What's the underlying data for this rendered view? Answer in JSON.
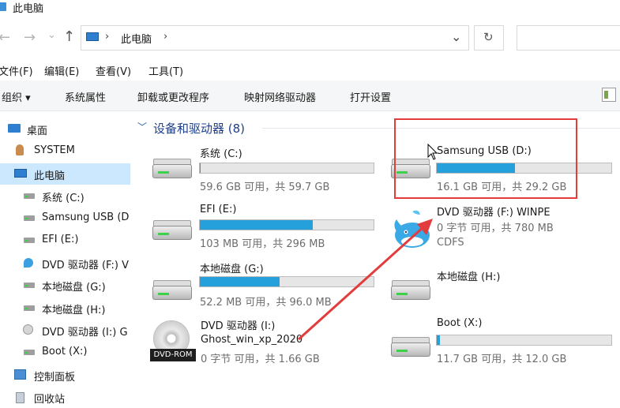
{
  "window": {
    "title": "此电脑"
  },
  "address": {
    "crumb": "此电脑",
    "sep_left": "›",
    "sep_right": "›"
  },
  "menu": [
    "文件(F)",
    "编辑(E)",
    "查看(V)",
    "工具(T)"
  ],
  "toolbar": {
    "organize": "组织",
    "items": [
      "系统属性",
      "卸载或更改程序",
      "映射网络驱动器",
      "打开设置"
    ]
  },
  "sidebar": {
    "items": [
      {
        "label": "桌面"
      },
      {
        "label": "SYSTEM"
      },
      {
        "label": "此电脑"
      },
      {
        "label": "系统 (C:)"
      },
      {
        "label": "Samsung USB (D"
      },
      {
        "label": "EFI (E:)"
      },
      {
        "label": "DVD 驱动器 (F:) V"
      },
      {
        "label": "本地磁盘 (G:)"
      },
      {
        "label": "本地磁盘 (H:)"
      },
      {
        "label": "DVD 驱动器 (I:) G"
      },
      {
        "label": "Boot (X:)"
      },
      {
        "label": "控制面板"
      },
      {
        "label": "回收站"
      }
    ]
  },
  "group": {
    "header": "设备和驱动器 (8)",
    "chevron": "﹀"
  },
  "drives": [
    {
      "name": "系统 (C:)",
      "free_text": "59.6 GB 可用，共 59.7 GB",
      "used_fraction": 0.003
    },
    {
      "name": "Samsung USB (D:)",
      "free_text": "16.1 GB 可用，共 29.2 GB",
      "used_fraction": 0.45
    },
    {
      "name": "EFI (E:)",
      "free_text": "103 MB 可用，共 296 MB",
      "used_fraction": 0.65
    },
    {
      "name": "DVD 驱动器 (F:) WINPE",
      "line2": "0 字节 可用，共 780 MB",
      "line3": "CDFS"
    },
    {
      "name": "本地磁盘 (G:)",
      "free_text": "52.2 MB 可用，共 96.0 MB",
      "used_fraction": 0.46
    },
    {
      "name": "本地磁盘 (H:)"
    },
    {
      "name": "DVD 驱动器 (I:)",
      "line2": "Ghost_win_xp_2020",
      "line3": "0 字节 可用，共 1.66 GB",
      "icon_label": "DVD-ROM"
    },
    {
      "name": "Boot (X:)",
      "free_text": "11.7 GB 可用，共 12.0 GB",
      "used_fraction": 0.02
    }
  ],
  "colors": {
    "accent": "#26a0da",
    "highlight": "#e23c3c",
    "selected": "#cce8ff"
  }
}
